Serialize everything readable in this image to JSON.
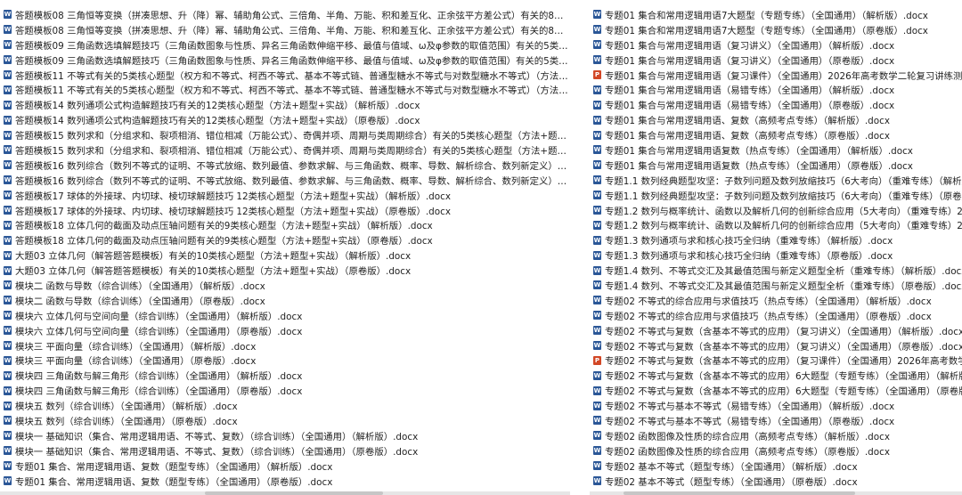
{
  "left_files": [
    {
      "icon": "word",
      "name": "答题模板08 三角恒等变换（拼凑思想、升（降）幂、辅助角公式、三倍角、半角、万能、积和差互化、正余弦平方差公式）有关的8类核心题型..."
    },
    {
      "icon": "word",
      "name": "答题模板08 三角恒等变换（拼凑思想、升（降）幂、辅助角公式、三倍角、半角、万能、积和差互化、正余弦平方差公式）有关的8类核心题型..."
    },
    {
      "icon": "word",
      "name": "答题模板09 三角函数选填解题技巧（三角函数图象与性质、异名三角函数伸缩平移、最值与值域、ω及φ参数的取值范围）有关的5类核..."
    },
    {
      "icon": "word",
      "name": "答题模板09 三角函数选填解题技巧（三角函数图象与性质、异名三角函数伸缩平移、最值与值域、ω及φ参数的取值范围）有关的5类核..."
    },
    {
      "icon": "word",
      "name": "答题模板11 不等式有关的5类核心题型（权方和不等式、柯西不等式、基本不等式链、普通型糖水不等式与对数型糖水不等式）（方法+题型+实..."
    },
    {
      "icon": "word",
      "name": "答题模板11 不等式有关的5类核心题型（权方和不等式、柯西不等式、基本不等式链、普通型糖水不等式与对数型糖水不等式）（方法+题型+实..."
    },
    {
      "icon": "word",
      "name": "答题模板14 数列通项公式构造解题技巧有关的12类核心题型（方法+题型+实战）（解析版）.docx"
    },
    {
      "icon": "word",
      "name": "答题模板14 数列通项公式构造解题技巧有关的12类核心题型（方法+题型+实战）（原卷版）.docx"
    },
    {
      "icon": "word",
      "name": "答题模板15 数列求和（分组求和、裂项相消、错位相减（万能公式）、奇偶并项、周期与类周期综合）有关的5类核心题型（方法+题型+实战）..."
    },
    {
      "icon": "word",
      "name": "答题模板15 数列求和（分组求和、裂项相消、错位相减（万能公式）、奇偶并项、周期与类周期综合）有关的5类核心题型（方法+题型+实战）..."
    },
    {
      "icon": "word",
      "name": "答题模板16 数列综合（数列不等式的证明、不等式放缩、数列最值、参数求解、与三角函数、概率、导数、解析综合、数列新定义）有关的9类..."
    },
    {
      "icon": "word",
      "name": "答题模板16 数列综合（数列不等式的证明、不等式放缩、数列最值、参数求解、与三角函数、概率、导数、解析综合、数列新定义）有关的9类..."
    },
    {
      "icon": "word",
      "name": "答题模板17 球体的外接球、内切球、棱切球解题技巧 12类核心题型（方法+题型+实战）（解析版）.docx"
    },
    {
      "icon": "word",
      "name": "答题模板17 球体的外接球、内切球、棱切球解题技巧 12类核心题型（方法+题型+实战）（原卷版）.docx"
    },
    {
      "icon": "word",
      "name": "答题模板18 立体几何的截面及动点压轴问题有关的9类核心题型（方法+题型+实战）（解析版）.docx"
    },
    {
      "icon": "word",
      "name": "答题模板18 立体几何的截面及动点压轴问题有关的9类核心题型（方法+题型+实战）（原卷版）.docx"
    },
    {
      "icon": "word",
      "name": "大题03 立体几何（解答题答题模板）有关的10类核心题型（方法+题型+实战）（解析版）.docx"
    },
    {
      "icon": "word",
      "name": "大题03 立体几何（解答题答题模板）有关的10类核心题型（方法+题型+实战）（原卷版）.docx"
    },
    {
      "icon": "word",
      "name": "模块二 函数与导数（综合训练）（全国通用）（解析版）.docx"
    },
    {
      "icon": "word",
      "name": "模块二 函数与导数（综合训练）（全国通用）（原卷版）.docx"
    },
    {
      "icon": "word",
      "name": "模块六 立体几何与空间向量（综合训练）（全国通用）（解析版）.docx"
    },
    {
      "icon": "word",
      "name": "模块六 立体几何与空间向量（综合训练）（全国通用）（原卷版）.docx"
    },
    {
      "icon": "word",
      "name": "模块三 平面向量（综合训练）（全国通用）（解析版）.docx"
    },
    {
      "icon": "word",
      "name": "模块三 平面向量（综合训练）（全国通用）（原卷版）.docx"
    },
    {
      "icon": "word",
      "name": "模块四 三角函数与解三角形（综合训练）（全国通用）（解析版）.docx"
    },
    {
      "icon": "word",
      "name": "模块四 三角函数与解三角形（综合训练）（全国通用）（原卷版）.docx"
    },
    {
      "icon": "word",
      "name": "模块五 数列（综合训练）（全国通用）（解析版）.docx"
    },
    {
      "icon": "word",
      "name": "模块五 数列（综合训练）（全国通用）（原卷版）.docx"
    },
    {
      "icon": "word",
      "name": "模块一 基础知识（集合、常用逻辑用语、不等式、复数）（综合训练）（全国通用）（解析版）.docx"
    },
    {
      "icon": "word",
      "name": "模块一 基础知识（集合、常用逻辑用语、不等式、复数）（综合训练）（全国通用）（原卷版）.docx"
    },
    {
      "icon": "word",
      "name": "专题01 集合、常用逻辑用语、复数（题型专练）（全国通用）（解析版）.docx"
    },
    {
      "icon": "word",
      "name": "专题01 集合、常用逻辑用语、复数（题型专练）（全国通用）（原卷版）.docx"
    }
  ],
  "right_files": [
    {
      "icon": "word",
      "name": "专题01 集合和常用逻辑用语7大题型（专题专练）（全国通用）（解析版）.docx"
    },
    {
      "icon": "word",
      "name": "专题01 集合和常用逻辑用语7大题型（专题专练）（全国通用）（原卷版）.docx"
    },
    {
      "icon": "word",
      "name": "专题01 集合与常用逻辑用语（复习讲义）（全国通用）（解析版）.docx"
    },
    {
      "icon": "word",
      "name": "专题01 集合与常用逻辑用语（复习讲义）（全国通用）（原卷版）.docx"
    },
    {
      "icon": "ppt",
      "name": "专题01 集合与常用逻辑用语（复习课件）（全国通用）2026年高考数学二轮复习讲练测.pptx"
    },
    {
      "icon": "word",
      "name": "专题01 集合与常用逻辑用语（易错专练）（全国通用）（解析版）.docx"
    },
    {
      "icon": "word",
      "name": "专题01 集合与常用逻辑用语（易错专练）（全国通用）（原卷版）.docx"
    },
    {
      "icon": "word",
      "name": "专题01 集合与常用逻辑用语、复数（高频考点专练）（解析版）.docx"
    },
    {
      "icon": "word",
      "name": "专题01 集合与常用逻辑用语、复数（高频考点专练）（原卷版）.docx"
    },
    {
      "icon": "word",
      "name": "专题01 集合与常用逻辑用语复数（热点专练）（全国通用）（解析版）.docx"
    },
    {
      "icon": "word",
      "name": "专题01 集合与常用逻辑用语复数（热点专练）（全国通用）（原卷版）.docx"
    },
    {
      "icon": "word",
      "name": "专题1.1 数列经典题型攻坚：子数列问题及数列放缩技巧（6大考向）（重难专练）（解析版）"
    },
    {
      "icon": "word",
      "name": "专题1.1 数列经典题型攻坚：子数列问题及数列放缩技巧（6大考向）（重难专练）（原卷版）"
    },
    {
      "icon": "word",
      "name": "专题1.2 数列与概率统计、函数以及解析几何的创新综合应用（5大考向）（重难专练）2026年"
    },
    {
      "icon": "word",
      "name": "专题1.2 数列与概率统计、函数以及解析几何的创新综合应用（5大考向）（重难专练）2026年"
    },
    {
      "icon": "word",
      "name": "专题1.3 数列通项与求和核心技巧全归纳（重难专练）（解析版）.docx"
    },
    {
      "icon": "word",
      "name": "专题1.3 数列通项与求和核心技巧全归纳（重难专练）（原卷版）.docx"
    },
    {
      "icon": "word",
      "name": "专题1.4 数列、不等式交汇及其最值范围与新定义题型全析（重难专练）（解析版）.docx"
    },
    {
      "icon": "word",
      "name": "专题1.4 数列、不等式交汇及其最值范围与新定义题型全析（重难专练）（原卷版）.docx"
    },
    {
      "icon": "word",
      "name": "专题02 不等式的综合应用与求值技巧（热点专练）（全国通用）（解析版）.docx"
    },
    {
      "icon": "word",
      "name": "专题02 不等式的综合应用与求值技巧（热点专练）（全国通用）（原卷版）.docx"
    },
    {
      "icon": "word",
      "name": "专题02 不等式与复数（含基本不等式的应用）（复习讲义）（全国通用）（解析版）.docx"
    },
    {
      "icon": "word",
      "name": "专题02 不等式与复数（含基本不等式的应用）（复习讲义）（全国通用）（原卷版）.docx"
    },
    {
      "icon": "ppt",
      "name": "专题02 不等式与复数（含基本不等式的应用）（复习课件）（全国通用）2026年高考数学二轮"
    },
    {
      "icon": "word",
      "name": "专题02 不等式与复数（含基本不等式的应用）6大题型（专题专练）（全国通用）（解析版）.d"
    },
    {
      "icon": "word",
      "name": "专题02 不等式与复数（含基本不等式的应用）6大题型（专题专练）（全国通用）（原卷版）.d"
    },
    {
      "icon": "word",
      "name": "专题02 不等式与基本不等式（易错专练）（全国通用）（解析版）.docx"
    },
    {
      "icon": "word",
      "name": "专题02 不等式与基本不等式（易错专练）（全国通用）（原卷版）.docx"
    },
    {
      "icon": "word",
      "name": "专题02 函数图像及性质的综合应用（高频考点专练）（解析版）.docx"
    },
    {
      "icon": "word",
      "name": "专题02 函数图像及性质的综合应用（高频考点专练）（原卷版）.docx"
    },
    {
      "icon": "word",
      "name": "专题02 基本不等式（题型专练）（全国通用）（解析版）.docx"
    },
    {
      "icon": "word",
      "name": "专题02 基本不等式（题型专练）（全国通用）（原卷版）.docx"
    }
  ]
}
